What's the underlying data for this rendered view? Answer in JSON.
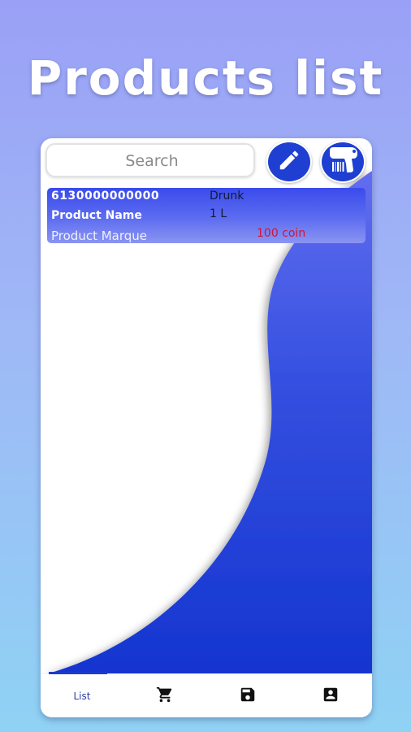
{
  "promo": {
    "title": "Products list"
  },
  "search": {
    "placeholder": "Search"
  },
  "toolbar": {
    "edit_icon": "pencil-icon",
    "scan_icon": "barcode-scanner-icon"
  },
  "products": [
    {
      "code": "6130000000000",
      "name": "Product Name",
      "marque": "Product Marque",
      "category": "Drunk",
      "volume": "1 L",
      "price": "100 coin"
    }
  ],
  "nav": {
    "items": [
      {
        "label": "List",
        "icon": "list-label",
        "active": true
      },
      {
        "label": "",
        "icon": "cart-icon"
      },
      {
        "label": "",
        "icon": "save-icon"
      },
      {
        "label": "",
        "icon": "account-box-icon"
      }
    ]
  },
  "colors": {
    "accent": "#1e3fd1",
    "price": "#d0143a",
    "card_gradient_top": "#3a4bec",
    "card_gradient_bottom": "#8a95f2"
  }
}
